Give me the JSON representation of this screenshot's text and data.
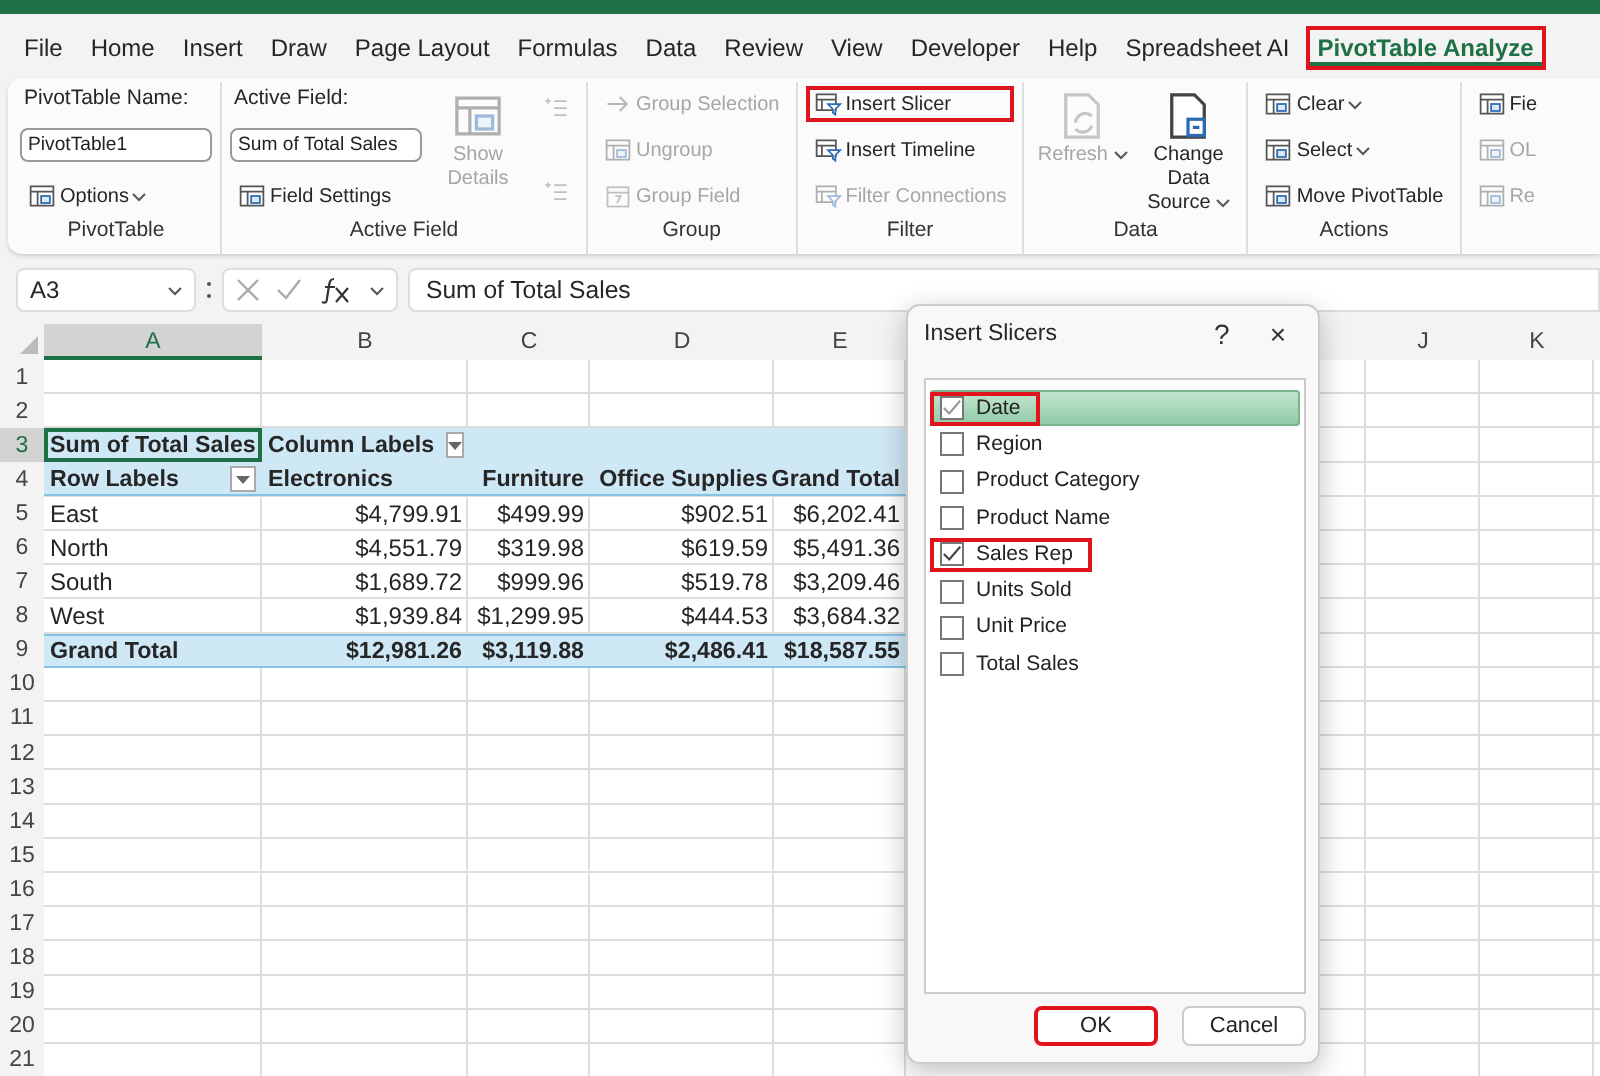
{
  "menu_tabs": [
    {
      "label": "File",
      "selected": false,
      "highlighted": false
    },
    {
      "label": "Home",
      "selected": false,
      "highlighted": false
    },
    {
      "label": "Insert",
      "selected": false,
      "highlighted": false
    },
    {
      "label": "Draw",
      "selected": false,
      "highlighted": false
    },
    {
      "label": "Page Layout",
      "selected": false,
      "highlighted": false
    },
    {
      "label": "Formulas",
      "selected": false,
      "highlighted": false
    },
    {
      "label": "Data",
      "selected": false,
      "highlighted": false
    },
    {
      "label": "Review",
      "selected": false,
      "highlighted": false
    },
    {
      "label": "View",
      "selected": false,
      "highlighted": false
    },
    {
      "label": "Developer",
      "selected": false,
      "highlighted": false
    },
    {
      "label": "Help",
      "selected": false,
      "highlighted": false
    },
    {
      "label": "Spreadsheet AI",
      "selected": false,
      "highlighted": false
    },
    {
      "label": "PivotTable Analyze",
      "selected": true,
      "highlighted": true
    }
  ],
  "ribbon": {
    "groups": [
      {
        "label": "PivotTable",
        "columns": [
          [
            {
              "kind": "caption",
              "text": "PivotTable Name:"
            },
            {
              "kind": "field",
              "value": "PivotTable1"
            },
            {
              "kind": "small",
              "text": "Options",
              "dropdown": true,
              "disabled": false,
              "highlighted": false
            }
          ]
        ]
      },
      {
        "label": "Active Field",
        "columns": [
          [
            {
              "kind": "caption",
              "text": "Active Field:"
            },
            {
              "kind": "field",
              "value": "Sum of Total Sales"
            },
            {
              "kind": "small",
              "text": "Field Settings",
              "dropdown": false,
              "disabled": false,
              "highlighted": false
            }
          ],
          [
            {
              "kind": "large",
              "text": "Show Details",
              "dropdown": false,
              "disabled": true,
              "highlighted": false
            }
          ],
          [
            {
              "kind": "icon",
              "dropdown": false,
              "disabled": true,
              "highlighted": false
            },
            {
              "kind": "icon",
              "dropdown": false,
              "disabled": true,
              "highlighted": false
            }
          ]
        ]
      },
      {
        "label": "Group",
        "columns": [
          [
            {
              "kind": "small",
              "text": "Group Selection",
              "dropdown": false,
              "disabled": true,
              "highlighted": false
            },
            {
              "kind": "small",
              "text": "Ungroup",
              "dropdown": false,
              "disabled": true,
              "highlighted": false
            },
            {
              "kind": "small",
              "text": "Group Field",
              "dropdown": false,
              "disabled": true,
              "highlighted": false
            }
          ]
        ]
      },
      {
        "label": "Filter",
        "columns": [
          [
            {
              "kind": "small",
              "text": "Insert Slicer",
              "dropdown": false,
              "disabled": false,
              "highlighted": true
            },
            {
              "kind": "small",
              "text": "Insert Timeline",
              "dropdown": false,
              "disabled": false,
              "highlighted": false
            },
            {
              "kind": "small",
              "text": "Filter Connections",
              "dropdown": false,
              "disabled": true,
              "highlighted": false
            }
          ]
        ]
      },
      {
        "label": "Data",
        "columns": [
          [
            {
              "kind": "large",
              "text": "Refresh",
              "dropdown": true,
              "disabled": true,
              "highlighted": false
            }
          ],
          [
            {
              "kind": "large",
              "text": "Change Data Source",
              "dropdown": true,
              "disabled": false,
              "highlighted": false
            }
          ]
        ]
      },
      {
        "label": "Actions",
        "columns": [
          [
            {
              "kind": "small",
              "text": "Clear",
              "dropdown": true,
              "disabled": false,
              "highlighted": false
            },
            {
              "kind": "small",
              "text": "Select",
              "dropdown": true,
              "disabled": false,
              "highlighted": false
            },
            {
              "kind": "small",
              "text": "Move PivotTable",
              "dropdown": false,
              "disabled": false,
              "highlighted": false
            }
          ]
        ]
      },
      {
        "columns": [
          [
            {
              "kind": "small",
              "text": "Fie",
              "dropdown": false,
              "disabled": false,
              "highlighted": false
            },
            {
              "kind": "small",
              "text": "OL",
              "dropdown": false,
              "disabled": true,
              "highlighted": false
            },
            {
              "kind": "small",
              "text": "Re",
              "dropdown": false,
              "disabled": true,
              "highlighted": false
            }
          ]
        ]
      }
    ]
  },
  "formula_bar": {
    "name_box": "A3",
    "formula": "Sum of Total Sales"
  },
  "sheet": {
    "columns_left": [
      {
        "label": "A",
        "selected": true
      },
      {
        "label": "B",
        "selected": false
      },
      {
        "label": "C",
        "selected": false
      },
      {
        "label": "D",
        "selected": false
      },
      {
        "label": "E",
        "selected": false
      }
    ],
    "columns_right": [
      {
        "label": "J",
        "selected": false
      },
      {
        "label": "K",
        "selected": false
      }
    ],
    "rows": [
      {
        "number": "1",
        "kind": "blank",
        "selected": false
      },
      {
        "number": "2",
        "kind": "blank",
        "selected": false
      },
      {
        "number": "3",
        "kind": "pivot_title",
        "selected": true,
        "cells": [
          "Sum of Total Sales",
          "Column Labels"
        ]
      },
      {
        "number": "4",
        "kind": "pivot_header",
        "selected": false,
        "cells": [
          "Row Labels",
          "Electronics",
          "Furniture",
          "Office Supplies",
          "Grand Total"
        ]
      },
      {
        "number": "5",
        "kind": "data",
        "selected": false,
        "cells": [
          "East",
          "$4,799.91",
          "$499.99",
          "$902.51",
          "$6,202.41"
        ]
      },
      {
        "number": "6",
        "kind": "data",
        "selected": false,
        "cells": [
          "North",
          "$4,551.79",
          "$319.98",
          "$619.59",
          "$5,491.36"
        ]
      },
      {
        "number": "7",
        "kind": "data",
        "selected": false,
        "cells": [
          "South",
          "$1,689.72",
          "$999.96",
          "$519.78",
          "$3,209.46"
        ]
      },
      {
        "number": "8",
        "kind": "data",
        "selected": false,
        "cells": [
          "West",
          "$1,939.84",
          "$1,299.95",
          "$444.53",
          "$3,684.32"
        ]
      },
      {
        "number": "9",
        "kind": "total",
        "selected": false,
        "cells": [
          "Grand Total",
          "$12,981.26",
          "$3,119.88",
          "$2,486.41",
          "$18,587.55"
        ]
      },
      {
        "number": "10",
        "kind": "blank",
        "selected": false
      },
      {
        "number": "11",
        "kind": "blank",
        "selected": false
      },
      {
        "number": "12",
        "kind": "blank",
        "selected": false
      },
      {
        "number": "13",
        "kind": "blank",
        "selected": false
      },
      {
        "number": "14",
        "kind": "blank",
        "selected": false
      },
      {
        "number": "15",
        "kind": "blank",
        "selected": false
      },
      {
        "number": "16",
        "kind": "blank",
        "selected": false
      },
      {
        "number": "17",
        "kind": "blank",
        "selected": false
      },
      {
        "number": "18",
        "kind": "blank",
        "selected": false
      },
      {
        "number": "19",
        "kind": "blank",
        "selected": false
      },
      {
        "number": "20",
        "kind": "blank",
        "selected": false
      },
      {
        "number": "21",
        "kind": "blank",
        "selected": false
      }
    ]
  },
  "dialog": {
    "title": "Insert Slicers",
    "help": "?",
    "close": "×",
    "fields": [
      {
        "label": "Date",
        "checked": true,
        "selected": true,
        "highlighted": true
      },
      {
        "label": "Region",
        "checked": false,
        "selected": false,
        "highlighted": false
      },
      {
        "label": "Product Category",
        "checked": false,
        "selected": false,
        "highlighted": false
      },
      {
        "label": "Product Name",
        "checked": false,
        "selected": false,
        "highlighted": false
      },
      {
        "label": "Sales Rep",
        "checked": true,
        "selected": false,
        "highlighted": true
      },
      {
        "label": "Units Sold",
        "checked": false,
        "selected": false,
        "highlighted": false
      },
      {
        "label": "Unit Price",
        "checked": false,
        "selected": false,
        "highlighted": false
      },
      {
        "label": "Total Sales",
        "checked": false,
        "selected": false,
        "highlighted": false
      }
    ],
    "buttons": [
      {
        "label": "OK",
        "highlighted": true
      },
      {
        "label": "Cancel",
        "highlighted": false
      }
    ]
  }
}
